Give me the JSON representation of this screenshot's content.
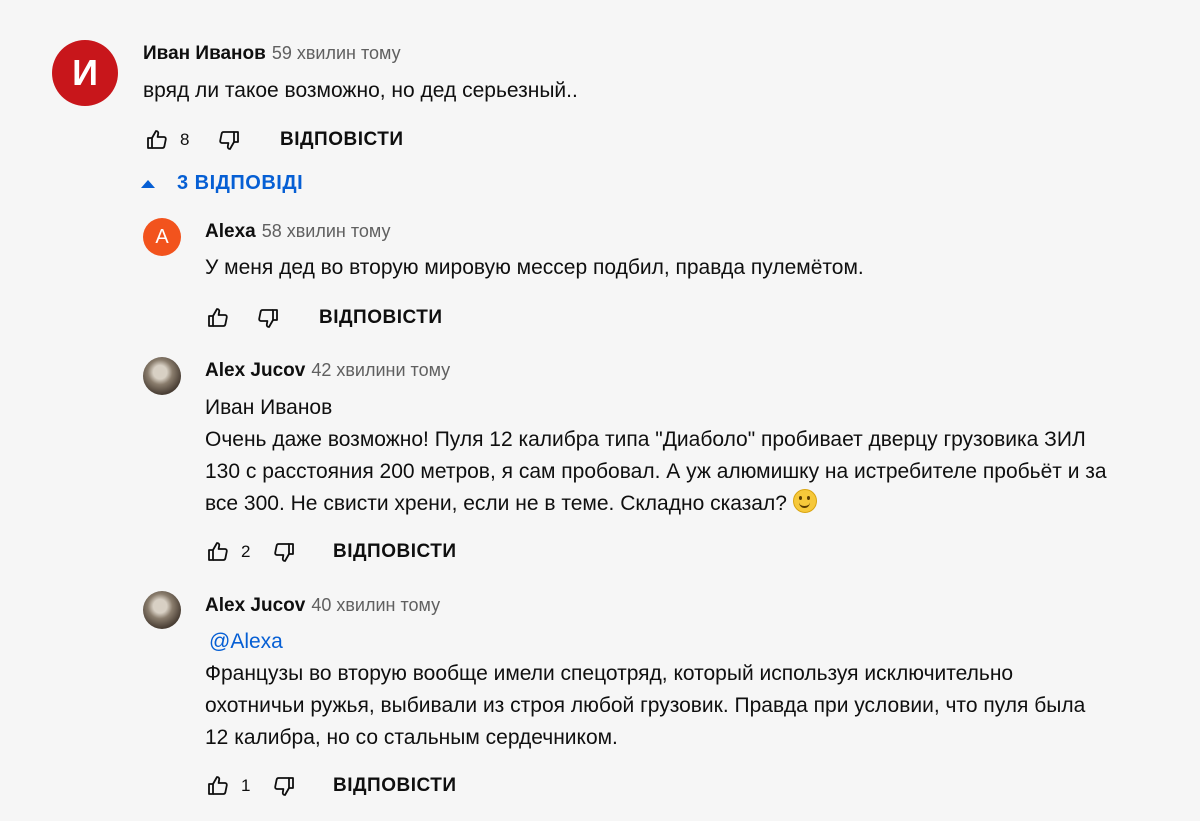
{
  "colors": {
    "accent": "#065fd4",
    "avatar_ivan": "#c8161b",
    "avatar_alexa": "#f2531d"
  },
  "reply_label": "ВІДПОВІСТИ",
  "main_comment": {
    "avatar_letter": "И",
    "author": "Иван Иванов",
    "time": "59 хвилин тому",
    "text": "вряд ли такое возможно, но дед серьезный..",
    "likes": "8"
  },
  "replies_toggle": {
    "label": "3 ВІДПОВІДІ",
    "icon": "caret-up-icon"
  },
  "replies": [
    {
      "avatar_letter": "А",
      "author": "Alexa",
      "time": "58 хвилин тому",
      "text": "У меня дед во вторую мировую мессер подбил, правда пулемётом.",
      "likes": ""
    },
    {
      "author": "Alex Jucov",
      "time": "42 хвилини тому",
      "addressee": "Иван Иванов",
      "lines": [
        "Очень даже возможно! Пуля 12 калибра типа \"Диаболо\" пробивает дверцу грузовика ЗИЛ",
        "130 с расстояния 200 метров, я сам пробовал. А уж алюмишку на истребителе пробьёт и за",
        "все 300. Не свисти хрени, если не в теме. Складно сказал?"
      ],
      "emoji": "smiley-emoji",
      "likes": "2"
    },
    {
      "author": "Alex Jucov",
      "time": "40 хвилин тому",
      "mention": "@Alexa",
      "lines": [
        "Французы во вторую вообще имели спецотряд, который используя исключительно",
        "охотничьи ружья, выбивали из строя любой грузовик. Правда при условии, что пуля была",
        "12 калибра, но со стальным сердечником."
      ],
      "likes": "1"
    }
  ]
}
